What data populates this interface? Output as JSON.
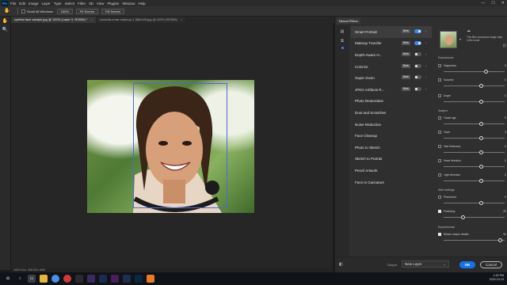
{
  "app": {
    "logo": "Ps"
  },
  "menu": [
    "File",
    "Edit",
    "Image",
    "Layer",
    "Type",
    "Select",
    "Filter",
    "3D",
    "View",
    "Plugins",
    "Window",
    "Help"
  ],
  "window_controls": {
    "minimize": "—",
    "maximize": "☐",
    "close": "✕"
  },
  "options": {
    "scroll_all": "Scroll All Windows",
    "zoom": "100%",
    "fit_screen": "Fit Screen",
    "fill_screen": "Fill Screen"
  },
  "tabs": [
    {
      "label": "cynthia face sample.jpg @ 100% (Layer 0, RGB/8) *",
      "close": "×"
    },
    {
      "label": "mustafa-omar-makeup-1-5f8ec05.jpg @ 100% (RGB/8)",
      "close": "×"
    }
  ],
  "status": {
    "text": "100%    Doc: 398.0K/1.46M"
  },
  "panel": {
    "title": "Neural Filters",
    "filters": [
      {
        "name": "Smart Portrait",
        "badge": "Beta",
        "toggle": "on"
      },
      {
        "name": "Makeup Transfer",
        "badge": "Beta",
        "toggle": "on"
      },
      {
        "name": "Depth-Aware H...",
        "badge": "Beta",
        "toggle": "off"
      },
      {
        "name": "Colorize",
        "badge": "Beta",
        "toggle": "off"
      },
      {
        "name": "Super Zoom",
        "badge": "Beta",
        "toggle": "off"
      },
      {
        "name": "JPEG Artifacts R...",
        "badge": "Beta",
        "toggle": "off"
      },
      {
        "name": "Photo Restoration"
      },
      {
        "name": "Dust and Scratches"
      },
      {
        "name": "Noise Reduction"
      },
      {
        "name": "Face Cleanup"
      },
      {
        "name": "Photo to Sketch"
      },
      {
        "name": "Sketch to Portrait"
      },
      {
        "name": "Pencil Artwork"
      },
      {
        "name": "Face to Caricature"
      }
    ],
    "thumb_note": "This filter processes image data in the cloud",
    "sections": {
      "expressions": "Expressions",
      "subject": "Subject",
      "web": "Web settings",
      "experimental": "Experimental"
    },
    "params": [
      {
        "label": "Happiness",
        "value": "0",
        "checked": false,
        "level": 0.69
      },
      {
        "label": "Surprise",
        "value": "0",
        "checked": false,
        "level": 0.62
      },
      {
        "label": "Anger",
        "value": "0",
        "checked": false,
        "level": 0.62
      },
      {
        "label": "Facial age",
        "value": "0",
        "checked": false,
        "level": 0.62
      },
      {
        "label": "Gaze",
        "value": "0",
        "checked": false,
        "level": 0.62
      },
      {
        "label": "Hair thickness",
        "value": "0",
        "checked": false,
        "level": 0.62
      },
      {
        "label": "Head direction",
        "value": "0",
        "checked": false,
        "level": 0.62
      },
      {
        "label": "Light direction",
        "value": "0",
        "checked": false,
        "level": 0.62
      },
      {
        "label": "Placement",
        "value": "0",
        "checked": false,
        "level": 0.62
      },
      {
        "label": "Featuring",
        "value": "20",
        "checked": true,
        "level": 0.32
      },
      {
        "label": "Retain unique details",
        "value": "90",
        "checked": true,
        "level": 0.93
      }
    ],
    "footer": {
      "output_label": "Output",
      "output_value": "New Layer",
      "ok": "OK",
      "cancel": "Cancel"
    }
  },
  "taskbar": {
    "time": "1:52 PM",
    "date": "2020-10-23"
  }
}
